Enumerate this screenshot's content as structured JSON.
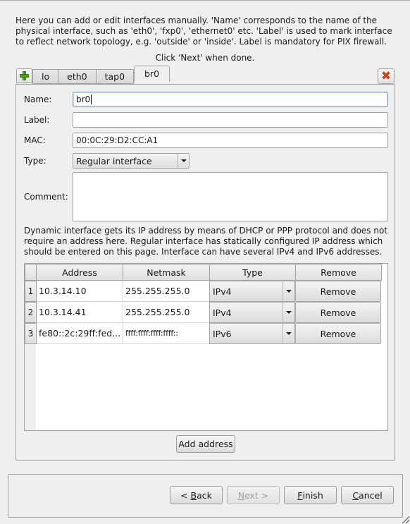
{
  "intro": {
    "text": "Here you can add or edit interfaces manually. 'Name' corresponds to the name of the physical interface, such as 'eth0', 'fxp0', 'ethernet0' etc. 'Label' is used to mark interface to reflect network topology, e.g. 'outside' or 'inside'. Label is mandatory for PIX firewall.",
    "click_next": "Click 'Next' when done."
  },
  "tabs": {
    "add_icon": "plus-icon",
    "close_icon": "close-icon",
    "items": [
      {
        "label": "lo",
        "active": false
      },
      {
        "label": "eth0",
        "active": false
      },
      {
        "label": "tap0",
        "active": false
      },
      {
        "label": "br0",
        "active": true
      }
    ]
  },
  "form": {
    "name_label": "Name:",
    "name_value": "br0",
    "label_label": "Label:",
    "label_value": "",
    "mac_label": "MAC:",
    "mac_value": "00:0C:29:D2:CC:A1",
    "type_label": "Type:",
    "type_value": "Regular interface",
    "comment_label": "Comment:",
    "comment_value": ""
  },
  "dynamic_note": "Dynamic interface gets its IP address by means of DHCP or PPP protocol and does not require an address here. Regular interface has statically configured IP address which should be entered on this page. Interface can have several IPv4 and IPv6 addresses.",
  "address_table": {
    "headers": [
      "Address",
      "Netmask",
      "Type",
      "Remove"
    ],
    "rows": [
      {
        "num": "1",
        "address": "10.3.14.10",
        "netmask": "255.255.255.0",
        "type": "IPv4",
        "remove": "Remove"
      },
      {
        "num": "2",
        "address": "10.3.14.41",
        "netmask": "255.255.255.0",
        "type": "IPv4",
        "remove": "Remove"
      },
      {
        "num": "3",
        "address": "fe80::2c:29ff:fed...",
        "netmask": "ffff:ffff:ffff:ffff::",
        "type": "IPv6",
        "remove": "Remove"
      }
    ],
    "add_button": "Add address"
  },
  "wizard_buttons": {
    "back": {
      "prefix": "< ",
      "mnemonic": "B",
      "rest": "ack",
      "enabled": true
    },
    "next": {
      "prefix": "",
      "mnemonic": "N",
      "rest": "ext >",
      "enabled": false
    },
    "finish": {
      "prefix": "",
      "mnemonic": "F",
      "rest": "inish",
      "enabled": true
    },
    "cancel": {
      "prefix": "",
      "mnemonic": "C",
      "rest": "ancel",
      "enabled": true
    }
  },
  "colors": {
    "background": "#efefef",
    "add_icon": "#4c9a1e",
    "close_icon": "#d2401a",
    "focus_border": "#8caac8",
    "disabled_text": "#a0a0a0"
  }
}
